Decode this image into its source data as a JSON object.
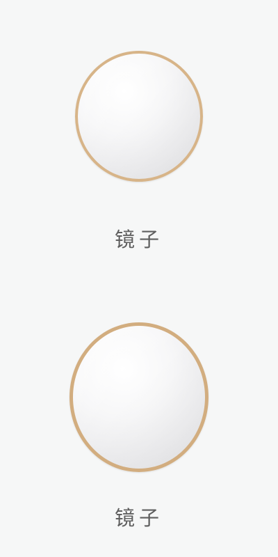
{
  "products": [
    {
      "label": "镜子",
      "icon": "round-mirror-icon",
      "frame_color": "#d7b488"
    },
    {
      "label": "镜子",
      "icon": "round-mirror-icon",
      "frame_color": "#d2ad7f"
    }
  ],
  "colors": {
    "background": "#f6f7f7",
    "label_text": "#5f5f5f"
  }
}
